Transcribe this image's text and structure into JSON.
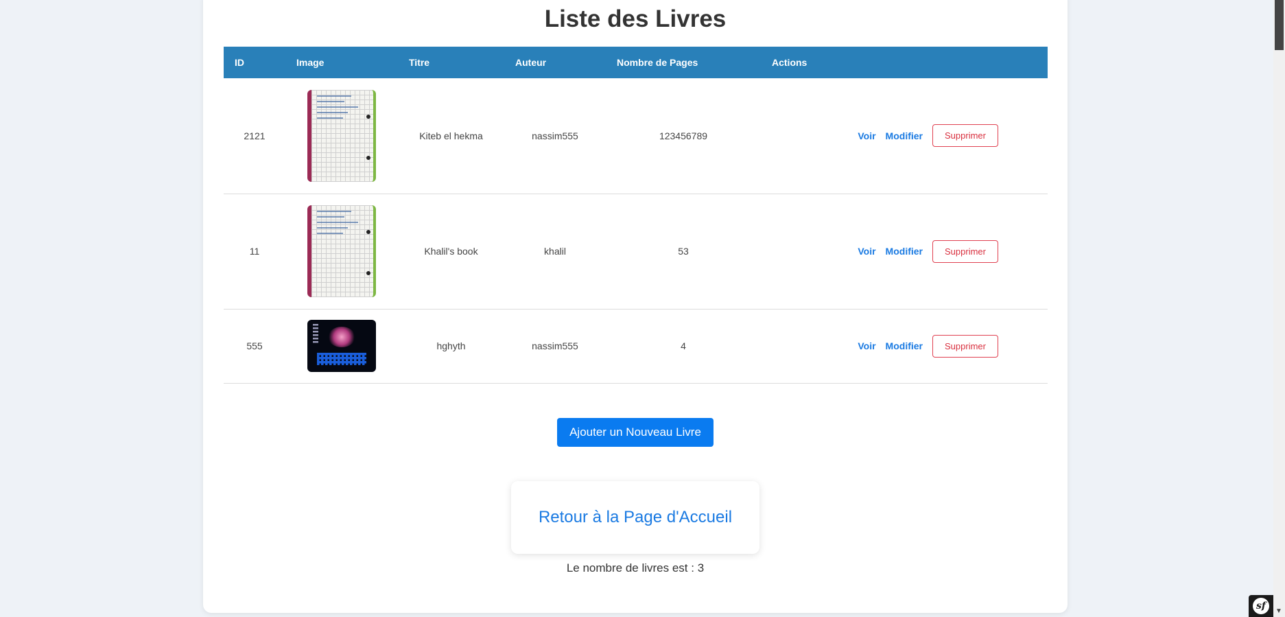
{
  "page": {
    "title": "Liste des Livres"
  },
  "table": {
    "headers": [
      "ID",
      "Image",
      "Titre",
      "Auteur",
      "Nombre de Pages",
      "Actions"
    ],
    "rows": [
      {
        "id": "2121",
        "image": "notebook-photo",
        "titre": "Kiteb el hekma",
        "auteur": "nassim555",
        "pages": "123456789"
      },
      {
        "id": "11",
        "image": "notebook-photo",
        "titre": "Khalil's book",
        "auteur": "khalil",
        "pages": "53"
      },
      {
        "id": "555",
        "image": "desk-setup-photo",
        "titre": "hghyth",
        "auteur": "nassim555",
        "pages": "4"
      }
    ],
    "actions": {
      "view": "Voir",
      "edit": "Modifier",
      "delete": "Supprimer"
    }
  },
  "buttons": {
    "add_book": "Ajouter un Nouveau Livre"
  },
  "home_link": "Retour à la Page d'Accueil",
  "count_text": "Le nombre de livres est : 3",
  "colors": {
    "header": "#2980b9",
    "primary": "#0a7bf0",
    "link": "#1a7ae2",
    "danger": "#d9303f",
    "background": "#eef2f7"
  },
  "toolbar_badge": {
    "icon": "symfony-icon",
    "label": "sf"
  }
}
